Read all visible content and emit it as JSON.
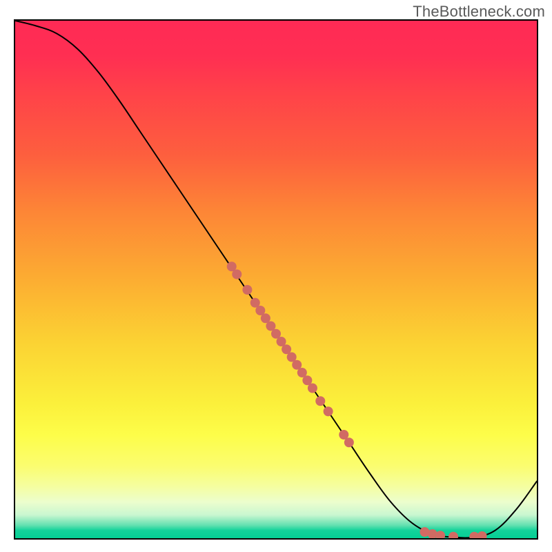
{
  "watermark": "TheBottleneck.com",
  "chart_data": {
    "type": "line",
    "title": "",
    "xlabel": "",
    "ylabel": "",
    "xlim": [
      0,
      100
    ],
    "ylim": [
      0,
      100
    ],
    "grid": false,
    "legend": false,
    "gradient_stops": [
      {
        "pos": 0,
        "color": "#ff2a55"
      },
      {
        "pos": 7,
        "color": "#ff2f52"
      },
      {
        "pos": 14,
        "color": "#ff4249"
      },
      {
        "pos": 26,
        "color": "#fd5f3e"
      },
      {
        "pos": 37,
        "color": "#fd8636"
      },
      {
        "pos": 50,
        "color": "#fcad32"
      },
      {
        "pos": 62,
        "color": "#fbd233"
      },
      {
        "pos": 74,
        "color": "#fbf03b"
      },
      {
        "pos": 80,
        "color": "#fdfd49"
      },
      {
        "pos": 86,
        "color": "#fbfd6f"
      },
      {
        "pos": 90,
        "color": "#f5fea0"
      },
      {
        "pos": 93,
        "color": "#ecfecd"
      },
      {
        "pos": 95.5,
        "color": "#c9f7d0"
      },
      {
        "pos": 97.5,
        "color": "#63e0b0"
      },
      {
        "pos": 98.5,
        "color": "#13d39a"
      },
      {
        "pos": 100,
        "color": "#05cf95"
      }
    ],
    "series": [
      {
        "name": "bottleneck-curve",
        "color": "#000000",
        "stroke_width": 2,
        "x": [
          0,
          4,
          8,
          12,
          16,
          20,
          24,
          28,
          32,
          36,
          40,
          44,
          48,
          52,
          56,
          60,
          64,
          68,
          72,
          76,
          80,
          84,
          88,
          92,
          96,
          100
        ],
        "y": [
          100,
          99,
          97.5,
          94.5,
          90,
          84.5,
          78.5,
          72.5,
          66.5,
          60.5,
          54.5,
          48.5,
          42.5,
          36.5,
          30.5,
          24.5,
          18.5,
          12.5,
          7.0,
          3.0,
          0.8,
          0.2,
          0.2,
          1.5,
          5.5,
          11.0
        ]
      }
    ],
    "points": {
      "name": "highlighted-points",
      "color": "#d16b63",
      "radius": 7,
      "data": [
        {
          "x": 41.5,
          "y": 52.5
        },
        {
          "x": 42.5,
          "y": 51.0
        },
        {
          "x": 44.5,
          "y": 48.0
        },
        {
          "x": 46.0,
          "y": 45.5
        },
        {
          "x": 47.0,
          "y": 44.0
        },
        {
          "x": 48.0,
          "y": 42.5
        },
        {
          "x": 49.0,
          "y": 41.0
        },
        {
          "x": 50.0,
          "y": 39.5
        },
        {
          "x": 51.0,
          "y": 38.0
        },
        {
          "x": 52.0,
          "y": 36.5
        },
        {
          "x": 53.0,
          "y": 35.0
        },
        {
          "x": 54.0,
          "y": 33.5
        },
        {
          "x": 55.0,
          "y": 32.0
        },
        {
          "x": 56.0,
          "y": 30.5
        },
        {
          "x": 57.0,
          "y": 29.0
        },
        {
          "x": 58.5,
          "y": 26.5
        },
        {
          "x": 60.0,
          "y": 24.5
        },
        {
          "x": 63.0,
          "y": 20.0
        },
        {
          "x": 64.0,
          "y": 18.5
        },
        {
          "x": 78.5,
          "y": 1.2
        },
        {
          "x": 80.0,
          "y": 0.8
        },
        {
          "x": 81.5,
          "y": 0.5
        },
        {
          "x": 84.0,
          "y": 0.3
        },
        {
          "x": 88.0,
          "y": 0.3
        },
        {
          "x": 89.5,
          "y": 0.4
        }
      ]
    }
  }
}
